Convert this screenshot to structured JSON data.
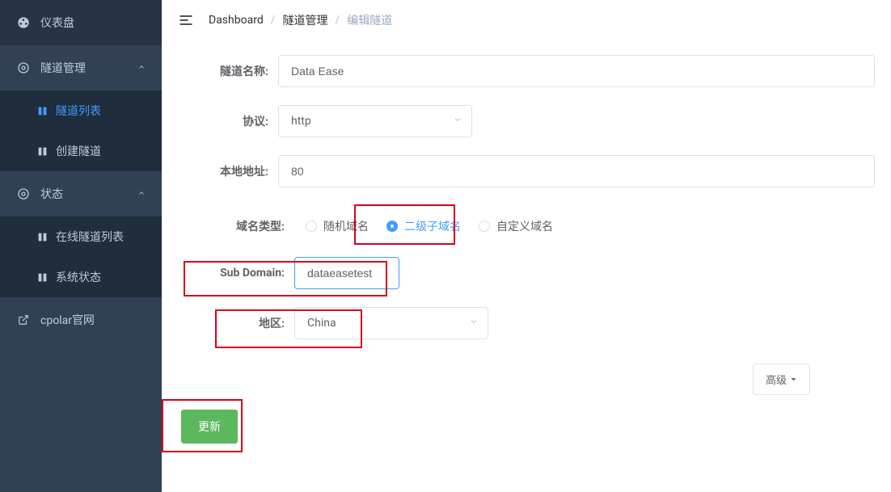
{
  "sidebar": {
    "dashboard": "仪表盘",
    "tunnel_mgmt": "隧道管理",
    "tunnel_list": "隧道列表",
    "create_tunnel": "创建隧道",
    "status": "状态",
    "online_tunnels": "在线隧道列表",
    "system_status": "系统状态",
    "cpolar_site": "cpolar官网"
  },
  "breadcrumb": {
    "a": "Dashboard",
    "b": "隧道管理",
    "c": "编辑隧道"
  },
  "form": {
    "name_label": "隧道名称:",
    "name_value": "Data Ease",
    "proto_label": "协议:",
    "proto_value": "http",
    "local_label": "本地地址:",
    "local_value": "80",
    "domain_type_label": "域名类型:",
    "domain_random": "随机域名",
    "domain_subdomain": "二级子域名",
    "domain_custom": "自定义域名",
    "subdomain_label": "Sub Domain:",
    "subdomain_value": "dataeasetest",
    "region_label": "地区:",
    "region_value": "China",
    "advanced": "高级",
    "submit": "更新"
  }
}
